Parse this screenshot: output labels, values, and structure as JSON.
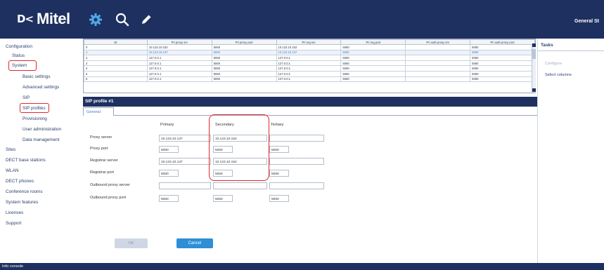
{
  "header": {
    "logo_mark": "D<",
    "logo_text": "Mitel",
    "icons": [
      "gear-icon",
      "search-icon",
      "pencil-icon"
    ],
    "right_text": "General  St"
  },
  "sidebar": {
    "items": [
      {
        "label": "Configuration"
      },
      {
        "label": "Status"
      },
      {
        "label": "System"
      },
      {
        "label": "Basic settings"
      },
      {
        "label": "Advanced settings"
      },
      {
        "label": "SIP"
      },
      {
        "label": "SIP profiles"
      },
      {
        "label": "Provisioning"
      },
      {
        "label": "User administration"
      },
      {
        "label": "Data management"
      },
      {
        "label": "Sites"
      },
      {
        "label": "DECT base stations"
      },
      {
        "label": "WLAN"
      },
      {
        "label": "DECT phones"
      },
      {
        "label": "Conference rooms"
      },
      {
        "label": "System features"
      },
      {
        "label": "Licenses"
      },
      {
        "label": "Support"
      }
    ]
  },
  "grid": {
    "columns": [
      "ID",
      "Pri proxy srv",
      "Pri proxy port",
      "Pri reg srv",
      "Pri reg port",
      "Pri outb proxy srv",
      "Pri outb proxy port"
    ],
    "rows": [
      [
        "0",
        "10.123.10.152",
        "5060",
        "10.123.10.152",
        "5060",
        "",
        "5060"
      ],
      [
        "1",
        "10.123.10.137",
        "5060",
        "10.123.10.137",
        "5060",
        "",
        "5060"
      ],
      [
        "2",
        "127.0.0.1",
        "5060",
        "127.0.0.1",
        "5060",
        "",
        "5060"
      ],
      [
        "3",
        "127.0.0.1",
        "5060",
        "127.0.0.1",
        "5060",
        "",
        "5060"
      ],
      [
        "4",
        "127.0.0.1",
        "5060",
        "127.0.0.1",
        "5060",
        "",
        "5060"
      ],
      [
        "5",
        "127.0.0.1",
        "5060",
        "127.0.0.1",
        "5060",
        "",
        "5060"
      ],
      [
        "6",
        "127.0.0.1",
        "5060",
        "127.0.0.1",
        "5060",
        "",
        "5060"
      ]
    ]
  },
  "tasks": {
    "title": "Tasks",
    "items": [
      {
        "label": "Configure",
        "disabled": true
      },
      {
        "label": "Select columns",
        "disabled": false
      }
    ]
  },
  "profile": {
    "title": "SIP profile #1",
    "tab_label": "General",
    "column_headers": [
      "Primary",
      "Secondary",
      "Tertiary"
    ],
    "rows": [
      {
        "label": "Proxy server",
        "values": [
          "10.123.10.137",
          "10.123.10.154",
          ""
        ]
      },
      {
        "label": "Proxy port",
        "values": [
          "5060",
          "5060",
          "5060"
        ]
      },
      {
        "label": "Registrar server",
        "values": [
          "10.123.10.137",
          "10.123.10.154",
          ""
        ]
      },
      {
        "label": "Registrar port",
        "values": [
          "5060",
          "5060",
          "5060"
        ]
      },
      {
        "label": "Outbound proxy server",
        "values": [
          "",
          "",
          ""
        ]
      },
      {
        "label": "Outbound proxy port",
        "values": [
          "5060",
          "5060",
          "5060"
        ]
      }
    ],
    "ok_label": "OK",
    "cancel_label": "Cancel"
  },
  "footer": {
    "label": "Info console"
  },
  "colors": {
    "brand_navy": "#1e3060",
    "accent_blue": "#2e8fd6",
    "highlight_red": "#e0282c"
  }
}
